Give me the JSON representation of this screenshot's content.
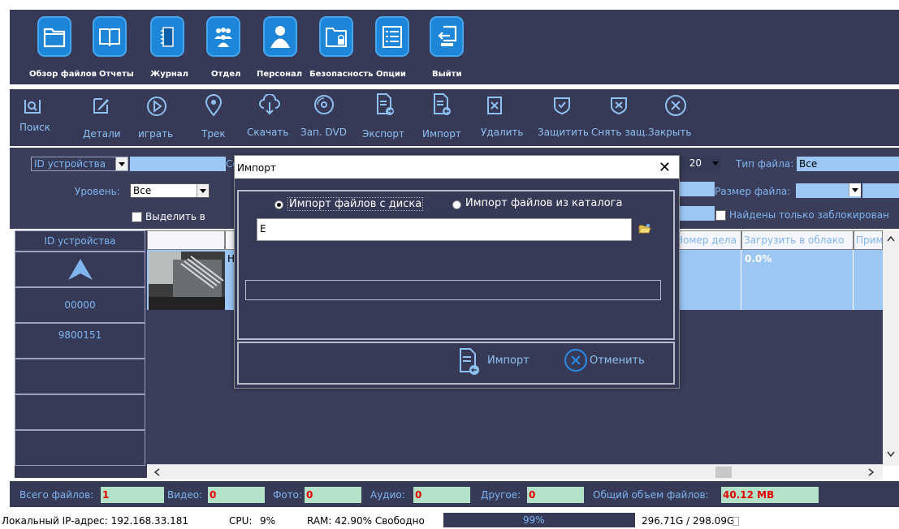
{
  "nav": [
    {
      "label": "Обзор файлов",
      "icon": "folder-icon"
    },
    {
      "label": "Отчеты",
      "icon": "book-icon"
    },
    {
      "label": "Журнал",
      "icon": "notebook-icon"
    },
    {
      "label": "Отдел",
      "icon": "group-icon"
    },
    {
      "label": "Персонал",
      "icon": "person-icon"
    },
    {
      "label": "Безопасность",
      "icon": "lock-folder-icon"
    },
    {
      "label": "Опции",
      "icon": "list-icon"
    },
    {
      "label": "Выйти",
      "icon": "exit-icon"
    }
  ],
  "toolbar": [
    {
      "label": "Поиск",
      "icon": "search-icon"
    },
    {
      "label": "Детали",
      "icon": "edit-icon"
    },
    {
      "label": "играть",
      "icon": "play-icon"
    },
    {
      "label": "Трек",
      "icon": "location-icon"
    },
    {
      "label": "Скачать",
      "icon": "cloud-download-icon"
    },
    {
      "label": "Зап. DVD",
      "icon": "disc-icon"
    },
    {
      "label": "Экспорт",
      "icon": "export-icon"
    },
    {
      "label": "Импорт",
      "icon": "import-icon"
    },
    {
      "label": "Удалить",
      "icon": "delete-icon"
    },
    {
      "label": "Защитить",
      "icon": "shield-check-icon"
    },
    {
      "label": "Снять защ.",
      "icon": "shield-x-icon"
    },
    {
      "label": "Закрыть",
      "icon": "close-circle-icon"
    }
  ],
  "filters": {
    "device_id_label": "ID устройства",
    "level_label": "Уровень:",
    "level_value": "Все",
    "select_all_label": "Выделить в",
    "c_label": "Сс",
    "count_value": "20",
    "file_type_label": "Тип файла:",
    "file_type_value": "Все",
    "file_size_label": "Размер файла:",
    "locked_only_label": "Найдены только заблокирован"
  },
  "devices": {
    "header": "ID устройства",
    "rows": [
      "00000",
      "9800151"
    ]
  },
  "table": {
    "headers": {
      "case": "Номер дела",
      "cloud": "Загрузить в облако",
      "note": "Прим"
    },
    "row": {
      "cloud_progress": "0.0%",
      "h_col": "Н"
    }
  },
  "footer": {
    "total_label": "Всего файлов:",
    "total_value": "1",
    "video_label": "Видео:",
    "video_value": "0",
    "photo_label": "Фото:",
    "photo_value": "0",
    "audio_label": "Аудио:",
    "audio_value": "0",
    "other_label": "Другое:",
    "other_value": "0",
    "size_label": "Общий объем файлов:",
    "size_value": "40.12 MB"
  },
  "status": {
    "ip": "Локальный IP-адрес: 192.168.33.181",
    "cpu_label": "CPU:",
    "cpu_value": "9%",
    "ram": "RAM: 42.90% Свободно",
    "disk_percent": "99%",
    "disk_space": "296.71G / 298.09G"
  },
  "dialog": {
    "title": "Импорт",
    "radio_disk": "Импорт файлов с диска",
    "radio_catalog": "Импорт файлов из каталога",
    "path_value": "E",
    "import_button": "Импорт",
    "cancel_button": "Отменить"
  },
  "colors": {
    "nav_bg": "#363a56",
    "accent": "#1e86d8",
    "label": "#7fb4ef",
    "red": "#e60000"
  }
}
